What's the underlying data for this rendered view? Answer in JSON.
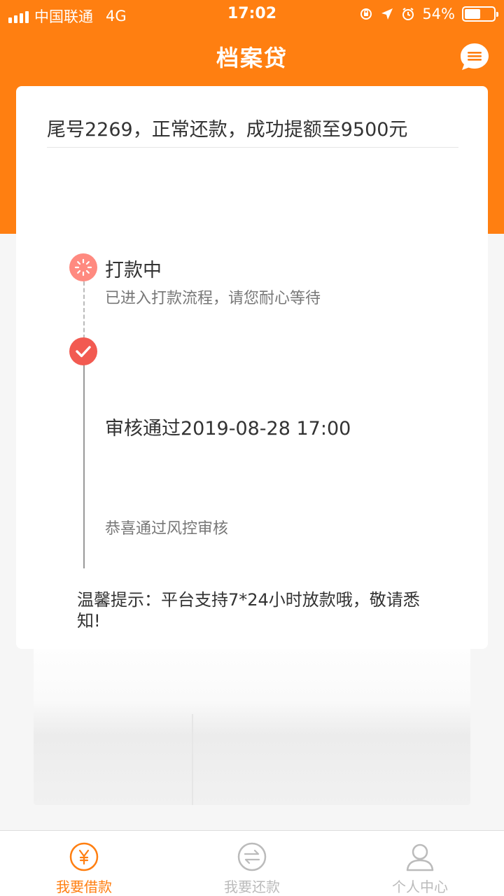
{
  "status_bar": {
    "carrier": "中国联通",
    "network": "4G",
    "time": "17:02",
    "battery": "54%",
    "battery_level": 0.54
  },
  "nav": {
    "title": "档案贷",
    "message_icon": "message-icon"
  },
  "notice": "尾号2269，正常还款，成功提额至9500元",
  "steps": [
    {
      "title": "打款中",
      "desc": "已进入打款流程，请您耐心等待",
      "status": "processing"
    },
    {
      "title": "审核通过2019-08-28 17:00",
      "desc": "恭喜通过风控审核",
      "status": "done"
    }
  ],
  "tip": "温馨提示：平台支持7*24小时放款哦，敬请悉知!",
  "tabs": [
    {
      "label": "我要借款",
      "icon": "yen-icon",
      "active": true
    },
    {
      "label": "我要还款",
      "icon": "exchange-icon",
      "active": false
    },
    {
      "label": "个人中心",
      "icon": "user-icon",
      "active": false
    }
  ],
  "colors": {
    "brand": "#ff7f11",
    "processing": "#ff8a80",
    "done": "#f25a51"
  }
}
